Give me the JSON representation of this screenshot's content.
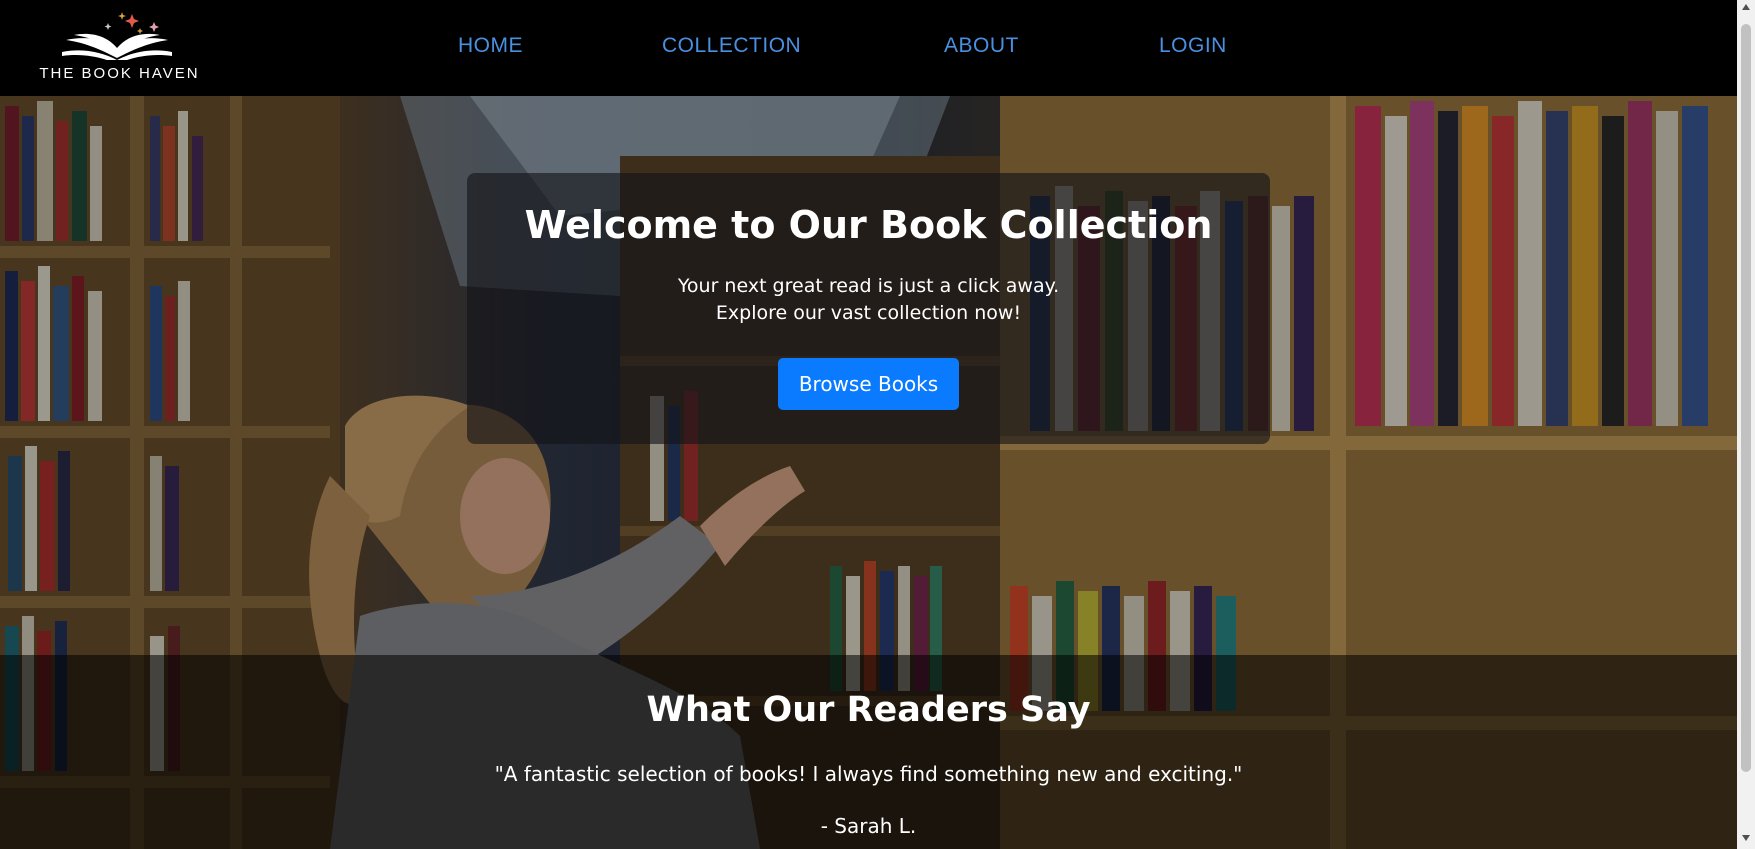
{
  "brand": {
    "name": "THE BOOK HAVEN",
    "logo_icon": "open-book-icon"
  },
  "nav": {
    "items": [
      {
        "label": "HOME"
      },
      {
        "label": "COLLECTION"
      },
      {
        "label": "ABOUT"
      },
      {
        "label": "LOGIN"
      }
    ],
    "link_color": "#4a90e2"
  },
  "hero": {
    "title": "Welcome to Our Book Collection",
    "subtitle_line1": "Your next great read is just a click away.",
    "subtitle_line2": "Explore our vast collection now!",
    "button_label": "Browse Books",
    "button_color": "#0a7bff"
  },
  "testimonials": {
    "title": "What Our Readers Say",
    "quote": "\"A fantastic selection of books! I always find something new and exciting.\"",
    "author": "- Sarah L."
  }
}
